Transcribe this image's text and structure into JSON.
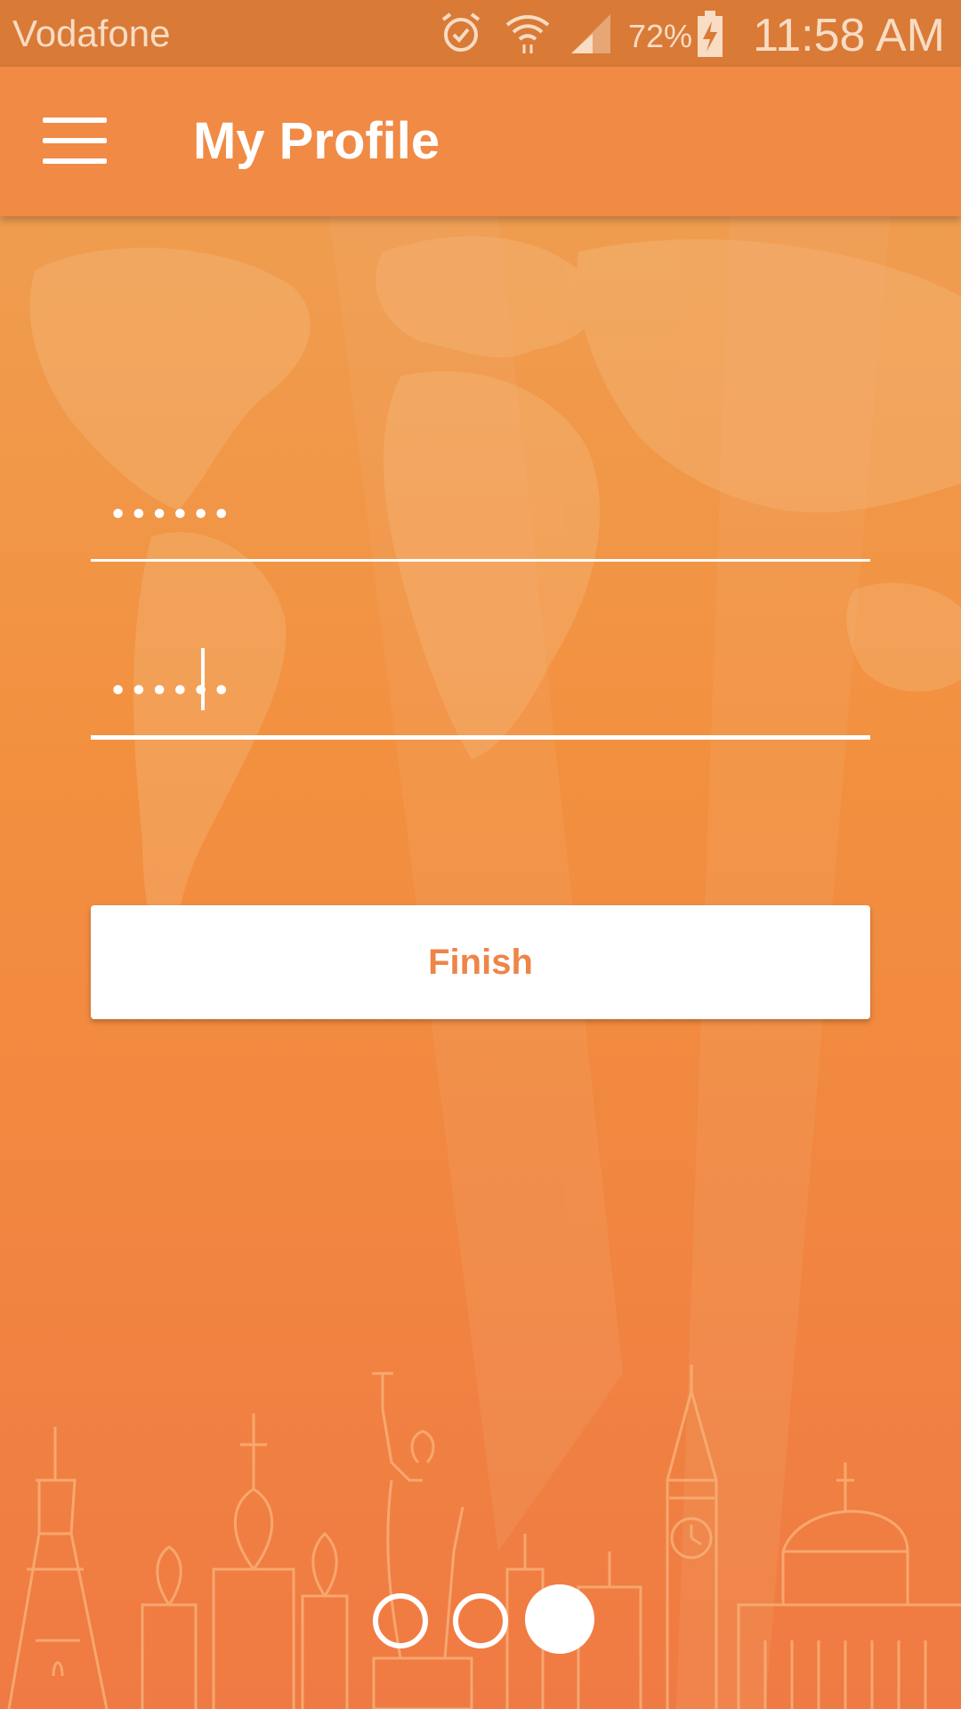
{
  "status_bar": {
    "carrier": "Vodafone",
    "battery": "72%",
    "time": "11:58 AM",
    "icons": [
      "alarm-icon",
      "wifi-icon",
      "signal-icon",
      "battery-charging-icon"
    ]
  },
  "app_bar": {
    "title": "My Profile",
    "menu_icon": "hamburger-menu-icon"
  },
  "form": {
    "password_value": "••••••",
    "confirm_password_value": "••••••"
  },
  "actions": {
    "finish_label": "Finish"
  },
  "pager": {
    "total": 3,
    "current": 3
  },
  "colors": {
    "primary": "#f08a45",
    "status_bar": "#d97a37",
    "button_text": "#ee8548"
  }
}
